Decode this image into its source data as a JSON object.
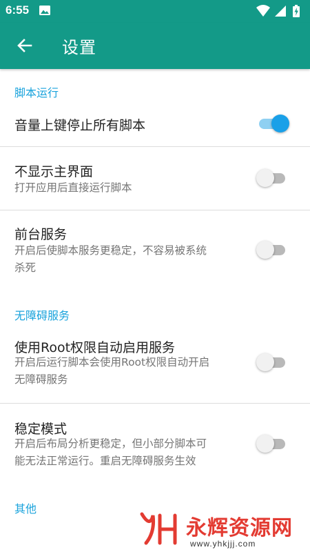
{
  "status_bar": {
    "time": "6:55",
    "icons": [
      "image-icon",
      "wifi-icon",
      "cellular-signal-icon",
      "battery-charging-icon"
    ]
  },
  "app_bar": {
    "back_icon": "arrow-left-icon",
    "title": "设置"
  },
  "colors": {
    "primary": "#139a88",
    "accent": "#1aa0e8",
    "section_header": "#1aa3dc"
  },
  "sections": [
    {
      "header": "脚本运行",
      "items": [
        {
          "title": "音量上键停止所有脚本",
          "enabled": true
        },
        {
          "title": "不显示主界面",
          "summary": "打开应用后直接运行脚本",
          "enabled": false
        },
        {
          "title": "前台服务",
          "summary_lines": [
            "开启后使脚本服务更稳定，不容易被系统",
            "杀死"
          ],
          "enabled": false
        }
      ]
    },
    {
      "header": "无障碍服务",
      "items": [
        {
          "title": "使用Root权限自动启用服务",
          "summary_lines": [
            "开启后运行脚本会使用Root权限自动开启",
            "无障碍服务"
          ],
          "enabled": false
        },
        {
          "title": "稳定模式",
          "summary_lines": [
            "开启后布局分析更稳定，但小部分脚本可",
            "能无法正常运行。重启无障碍服务生效"
          ],
          "enabled": false
        }
      ]
    },
    {
      "header": "其他",
      "items": []
    }
  ],
  "watermark": {
    "text": "永辉资源网",
    "url": "www.yhkjjj.com"
  }
}
